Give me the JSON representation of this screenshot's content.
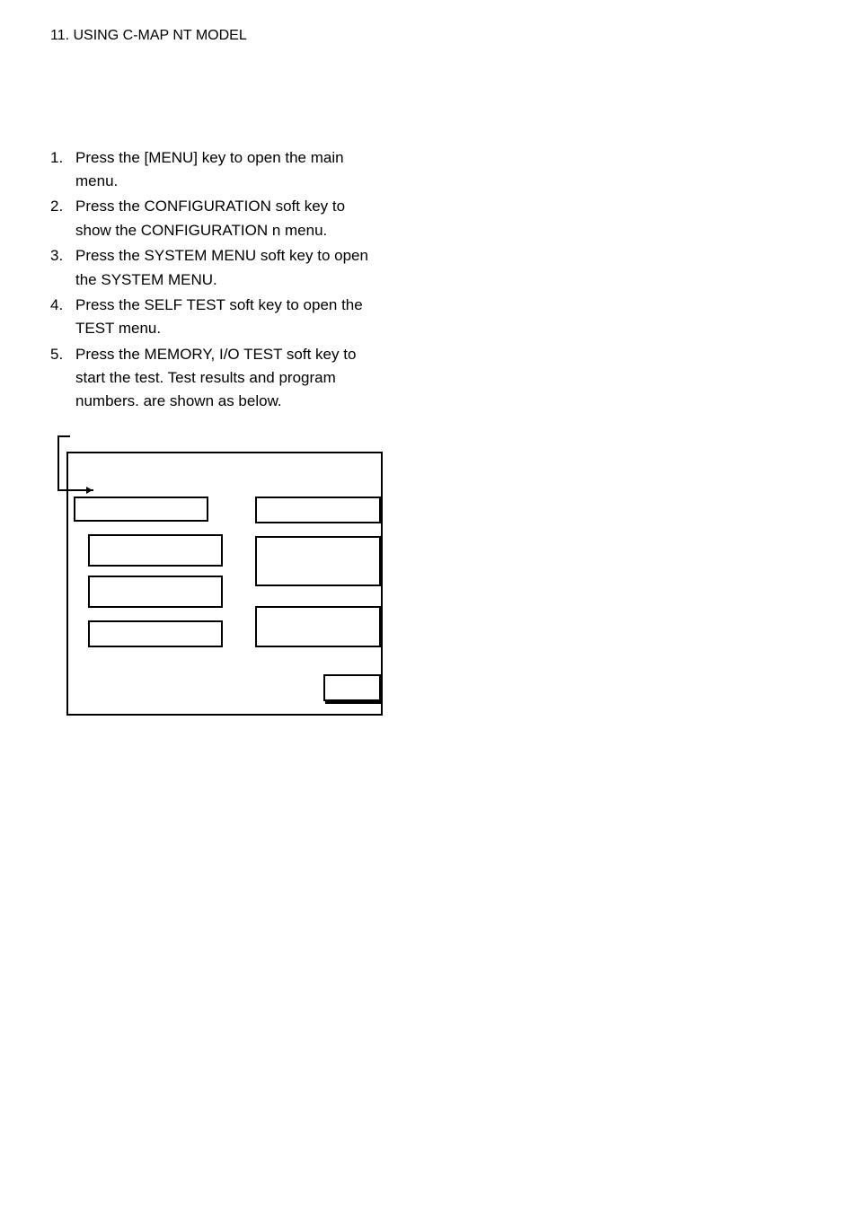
{
  "header": {
    "text": "11. USING C-MAP NT MODEL"
  },
  "list": {
    "items": [
      {
        "num": "1.",
        "text": "Press the [MENU] key to open the main menu."
      },
      {
        "num": "2.",
        "text": "Press the CONFIGURATION soft key to show the CONFIGURATION n menu."
      },
      {
        "num": "3.",
        "text": "Press the SYSTEM MENU soft key to open the SYSTEM MENU."
      },
      {
        "num": "4.",
        "text": "Press the SELF TEST soft key to open the TEST menu."
      },
      {
        "num": "5.",
        "text": "Press the MEMORY, I/O TEST soft key to start the test. Test results and program numbers. are shown as below."
      }
    ]
  }
}
